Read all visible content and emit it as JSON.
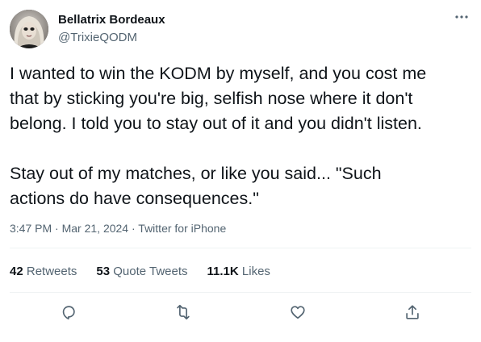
{
  "author": {
    "display_name": "Bellatrix Bordeaux",
    "handle": "@TrixieQODM"
  },
  "tweet": {
    "text": "I wanted to win the KODM by myself, and you cost me\nthat by sticking you're big, selfish nose where it don't\nbelong. I told you to stay out of it and you didn't listen.\n\nStay out of my matches, or like you said... \"Such\nactions do have consequences.\"",
    "time": "3:47 PM",
    "separator_1": " · ",
    "date": "Mar 21, 2024",
    "separator_2": " · ",
    "source": "Twitter for iPhone"
  },
  "stats": {
    "retweets_count": "42",
    "retweets_label": "Retweets",
    "quotes_count": "53",
    "quotes_label": "Quote Tweets",
    "likes_count": "11.1K",
    "likes_label": "Likes"
  },
  "icons": {
    "more": "more-icon",
    "reply": "reply-icon",
    "retweet": "retweet-icon",
    "like": "heart-icon",
    "share": "share-icon"
  },
  "colors": {
    "primary_text": "#0f1419",
    "secondary_text": "#536471",
    "divider": "#eff3f4"
  }
}
